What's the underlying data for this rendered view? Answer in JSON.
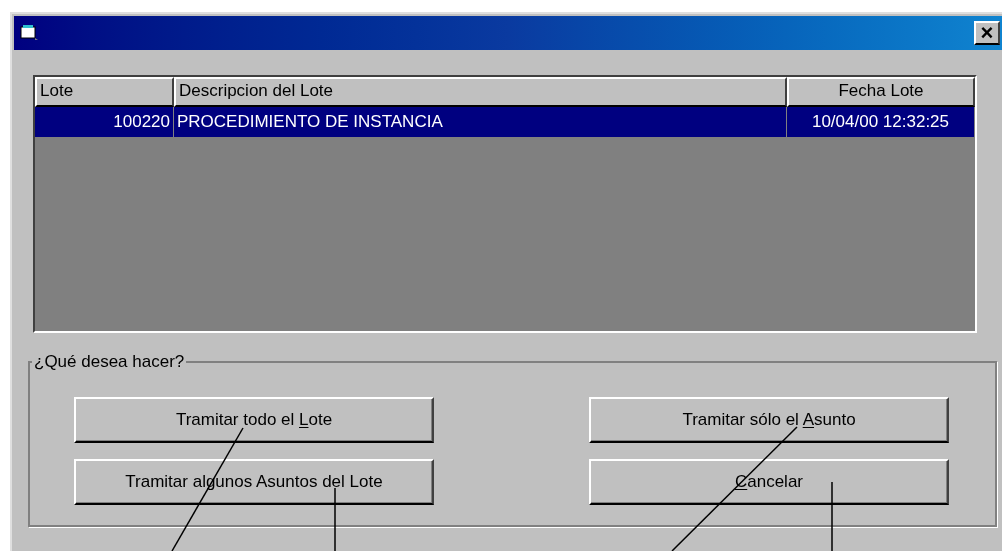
{
  "window": {
    "close_label": "×"
  },
  "table": {
    "columns": [
      "Lote",
      "Descripcion del Lote",
      "Fecha Lote"
    ],
    "rows": [
      {
        "selected": true,
        "cells": [
          "100220",
          "PROCEDIMIENTO DE INSTANCIA",
          "10/04/00 12:32:25"
        ]
      }
    ]
  },
  "group": {
    "title": "¿Qué desea hacer?",
    "buttons": [
      {
        "parts": [
          {
            "text": "Tramitar todo el ",
            "underlined": false
          },
          {
            "text": "L",
            "underlined": true
          },
          {
            "text": "ote",
            "underlined": false
          }
        ]
      },
      {
        "parts": [
          {
            "text": "Tramitar sólo el ",
            "underlined": false
          },
          {
            "text": "A",
            "underlined": true
          },
          {
            "text": "sunto",
            "underlined": false
          }
        ]
      },
      {
        "parts": [
          {
            "text": "Tramitar algunos Asuntos del Lote",
            "underlined": false
          }
        ]
      },
      {
        "parts": [
          {
            "text": "C",
            "underlined": true
          },
          {
            "text": "ancelar",
            "underlined": false
          }
        ]
      }
    ]
  }
}
